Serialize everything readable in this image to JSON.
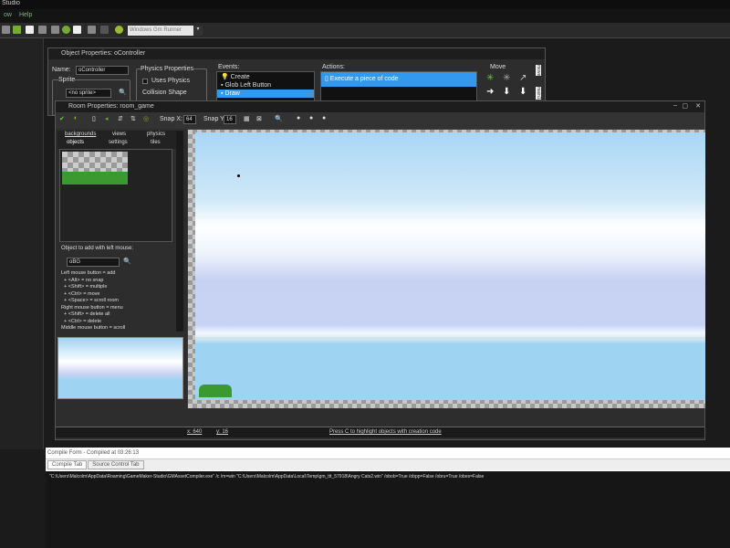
{
  "app": {
    "title": "Studio",
    "menu": [
      "ow",
      "Help"
    ],
    "runner": "Windows Gm Runner"
  },
  "object_window": {
    "title": "Object Properties: oController",
    "name_label": "Name:",
    "name_value": "oController",
    "sprite_label": "Sprite",
    "sprite_value": "<no sprite>",
    "physics_label": "Physics Properties",
    "uses_physics": "Uses Physics",
    "collision_label": "Collision Shape",
    "events_label": "Events:",
    "events": [
      "Create",
      "Glob Left Button",
      "Draw"
    ],
    "actions_label": "Actions:",
    "actions": [
      "Execute a piece of code"
    ],
    "move_label": "Move",
    "side_tabs": [
      "move",
      "main1"
    ]
  },
  "room_window": {
    "title": "Room Properties: room_game",
    "snap_x_label": "Snap X:",
    "snap_x": "64",
    "snap_y_label": "Snap Y:",
    "snap_y": "16",
    "tabs_row1": [
      "backgrounds",
      "views",
      "physics"
    ],
    "tabs_row2": [
      "objects",
      "settings",
      "tiles"
    ],
    "object_to_add_label": "Object to add with left mouse:",
    "object_value": "oBG",
    "help_lines": [
      "Left mouse button = add",
      "  + <Alt> = no snap",
      "  + <Shift> = multiple",
      "  + <Ctrl> = move",
      "  + <Space> = scroll room",
      "Right mouse button = menu",
      "  + <Shift> = delete all",
      "  + <Ctrl> = delete",
      "Middle mouse button = scroll"
    ],
    "status": {
      "x": "x: 640",
      "y": "y: 16",
      "hint": "Press C to highlight objects with creation code"
    }
  },
  "compile": {
    "header": "Compile Form - Compiled at 03:26:13",
    "tabs": [
      "Compile Tab",
      "Source Control Tab"
    ],
    "output": "\"C:\\Users\\Malcolm\\AppData\\Roaming\\GameMaker-Studio\\GMAssetCompiler.exe\" /c /m=win \"C:\\Users\\Malcolm\\AppData\\Local\\Temp\\gm_ttt_57918\\Angry Cats2.win\" /obob=True /obpp=False /obru=True /obes=False"
  }
}
